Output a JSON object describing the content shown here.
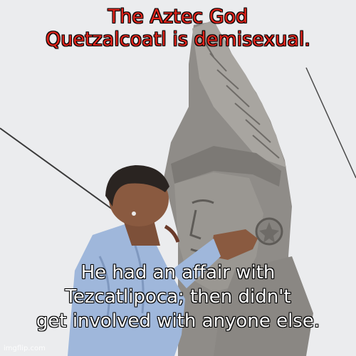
{
  "meme": {
    "top_caption": {
      "line1": "The Aztec God",
      "line2": "Quetzalcoatl is demisexual."
    },
    "bottom_caption": {
      "line1": "He had an affair with",
      "line2": "Tezcatlipoca; then didn't",
      "line3": "get involved with anyone else."
    },
    "watermark": "imgflip.com"
  },
  "colors": {
    "sky": "#ebecee",
    "statue_stone": "#8f8c88",
    "shirt": "#9fb7db",
    "skin": "#8a5a40",
    "hair": "#2a2421",
    "top_caption_text": "#e0241c",
    "bottom_caption_text": "#ffffff",
    "text_outline": "#000000"
  }
}
